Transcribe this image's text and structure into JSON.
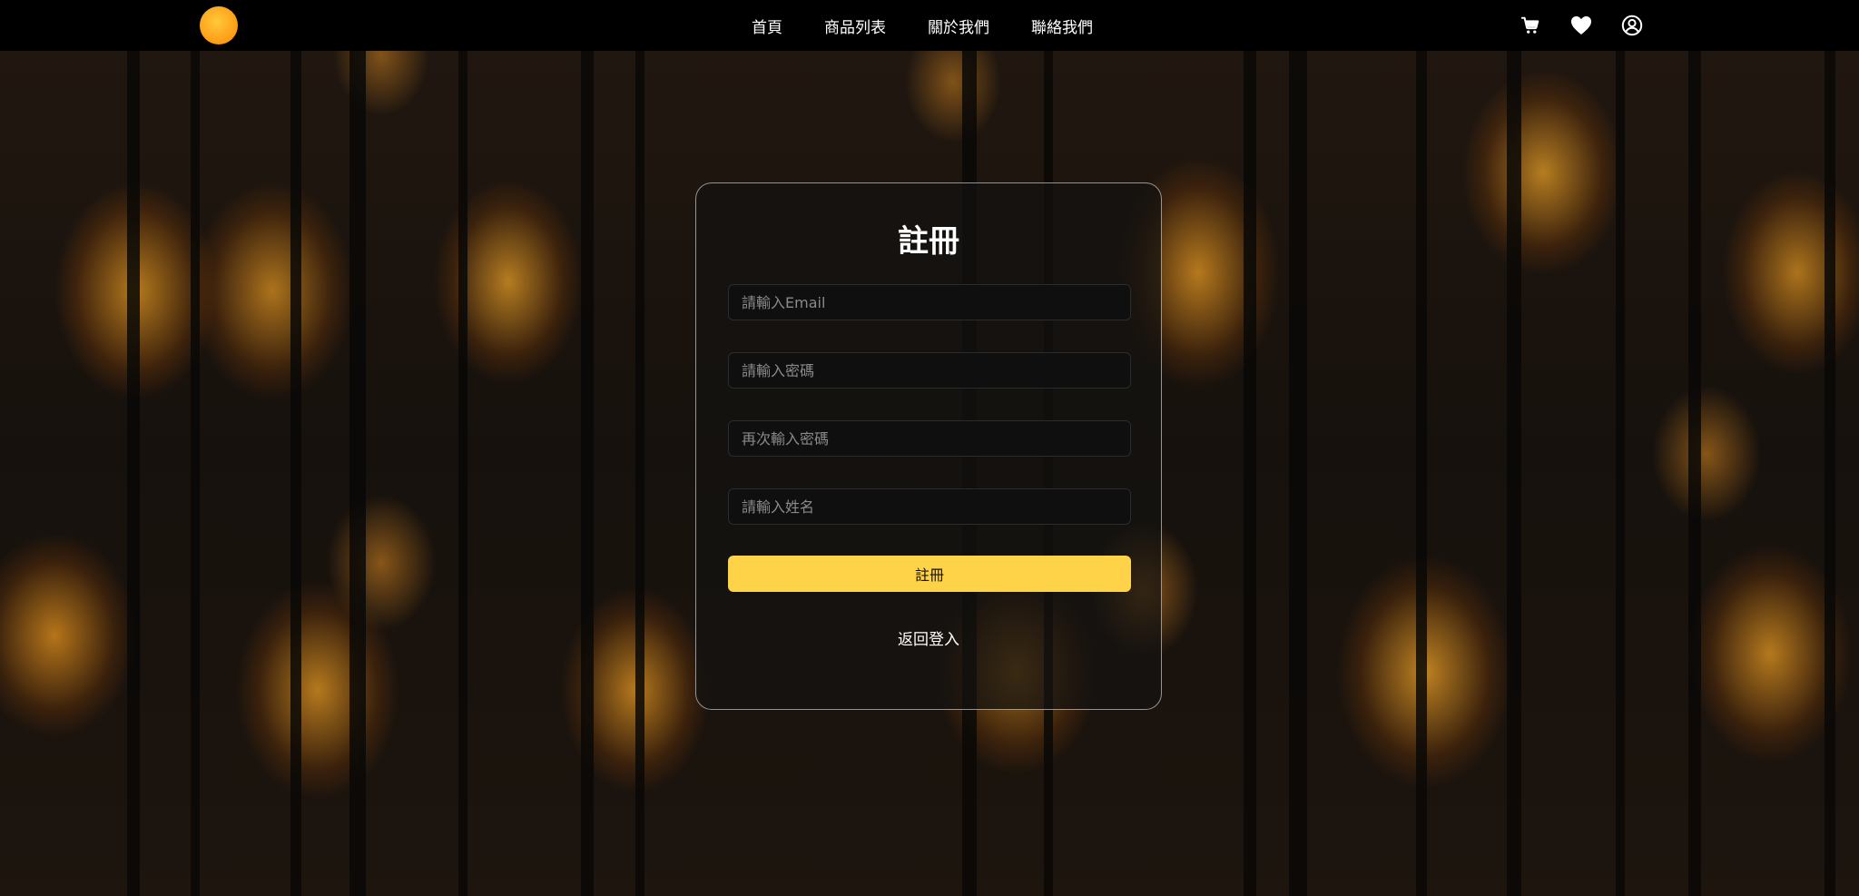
{
  "nav": {
    "links": [
      "首頁",
      "商品列表",
      "關於我們",
      "聯絡我們"
    ],
    "icons": [
      "cart-icon",
      "heart-icon",
      "user-icon"
    ]
  },
  "register": {
    "title": "註冊",
    "email_placeholder": "請輸入Email",
    "password_placeholder": "請輸入密碼",
    "confirm_password_placeholder": "再次輸入密碼",
    "name_placeholder": "請輸入姓名",
    "submit_label": "註冊",
    "back_to_login": "返回登入"
  },
  "colors": {
    "accent": "#ffd347",
    "logo": "#ffa51d",
    "navbar": "#000000"
  }
}
